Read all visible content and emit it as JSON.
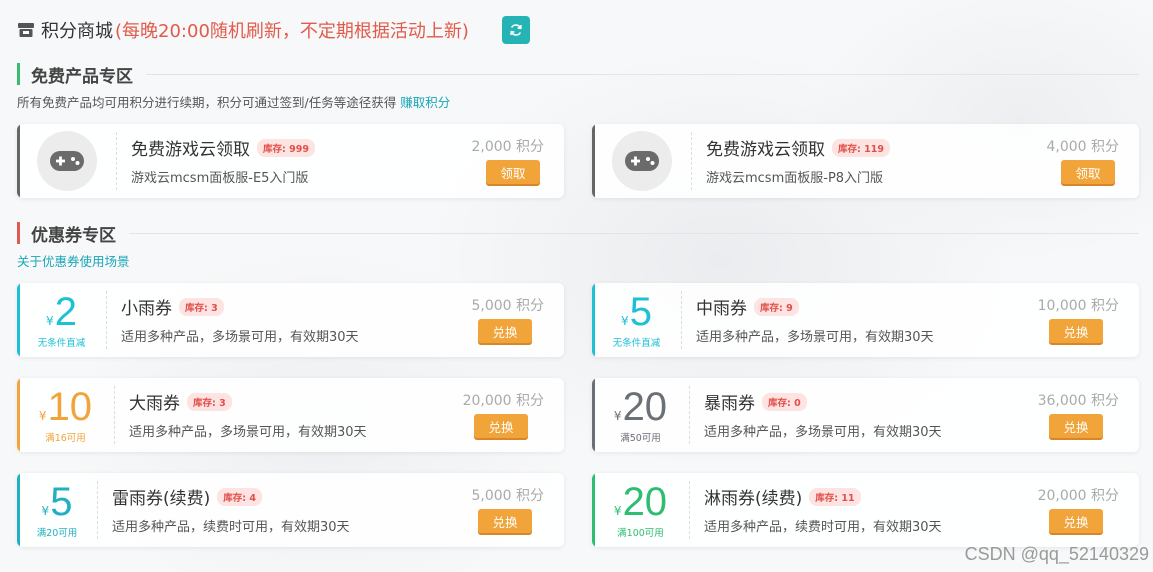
{
  "header": {
    "title": "积分商城",
    "note": "(每晚20:00随机刷新，不定期根据活动上新)",
    "refresh_icon": "refresh-icon"
  },
  "free_section": {
    "title": "免费产品专区",
    "desc": "所有免费产品均可用积分进行续期，积分可通过签到/任务等途径获得",
    "link": "赚取积分",
    "accent": "#3cba6f",
    "items": [
      {
        "title": "免费游戏云领取",
        "stock": "库存: 999",
        "desc": "游戏云mcsm面板服-E5入门版",
        "price": "2,000 积分",
        "button": "领取",
        "icon": "gamepad-icon"
      },
      {
        "title": "免费游戏云领取",
        "stock": "库存: 119",
        "desc": "游戏云mcsm面板服-P8入门版",
        "price": "4,000 积分",
        "button": "领取",
        "icon": "gamepad-icon"
      }
    ]
  },
  "coupon_section": {
    "title": "优惠券专区",
    "link": "关于优惠券使用场景",
    "accent": "#e05a55",
    "items": [
      {
        "currency": "¥",
        "amount": "2",
        "condition": "无条件直减",
        "title": "小雨券",
        "stock": "库存: 3",
        "desc": "适用多种产品，多场景可用，有效期30天",
        "price": "5,000 积分",
        "button": "兑换",
        "color": "#1ec0d6"
      },
      {
        "currency": "¥",
        "amount": "5",
        "condition": "无条件直减",
        "title": "中雨券",
        "stock": "库存: 9",
        "desc": "适用多种产品，多场景可用，有效期30天",
        "price": "10,000 积分",
        "button": "兑换",
        "color": "#1ec0d6"
      },
      {
        "currency": "¥",
        "amount": "10",
        "condition": "满16可用",
        "title": "大雨券",
        "stock": "库存: 3",
        "desc": "适用多种产品，多场景可用，有效期30天",
        "price": "20,000 积分",
        "button": "兑换",
        "color": "#f1a43a"
      },
      {
        "currency": "¥",
        "amount": "20",
        "condition": "满50可用",
        "title": "暴雨券",
        "stock": "库存: 0",
        "desc": "适用多种产品，多场景可用，有效期30天",
        "price": "36,000 积分",
        "button": "兑换",
        "color": "#6b6f76"
      },
      {
        "currency": "¥",
        "amount": "5",
        "condition": "满20可用",
        "title": "雷雨券(续费)",
        "stock": "库存: 4",
        "desc": "适用多种产品，续费时可用，有效期30天",
        "price": "5,000 积分",
        "button": "兑换",
        "color": "#23afc1"
      },
      {
        "currency": "¥",
        "amount": "20",
        "condition": "满100可用",
        "title": "淋雨券(续费)",
        "stock": "库存: 11",
        "desc": "适用多种产品，续费时可用，有效期30天",
        "price": "20,000 积分",
        "button": "兑换",
        "color": "#2fbd72"
      }
    ]
  },
  "watermark": "CSDN @qq_52140329"
}
